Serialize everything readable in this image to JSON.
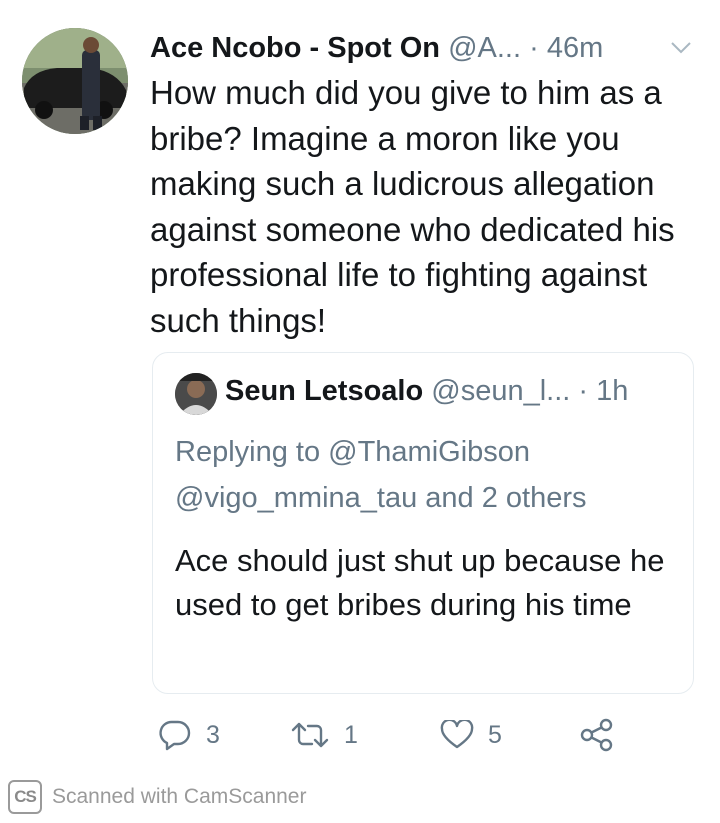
{
  "tweet": {
    "author_name": "Ace Ncobo - Spot On",
    "handle": "@A...",
    "separator": "·",
    "time": "46m",
    "text": "How much did you give to him as a bribe? Imagine a moron like you making such a ludicrous allegation against someone who dedicated his professional life to fighting against such things!",
    "avatar_icon": "profile-photo-man-with-car",
    "menu_icon": "chevron-down-icon"
  },
  "quoted_tweet": {
    "author_name": "Seun Letsoalo",
    "handle": "@seun_l...",
    "separator": "·",
    "time": "1h",
    "replying_line1": "Replying to @ThamiGibson",
    "replying_line2": "@vigo_mmina_tau and 2 others",
    "text": "Ace should just shut up because he used to get bribes during his time",
    "avatar_icon": "profile-photo-small"
  },
  "actions": {
    "reply_count": "3",
    "retweet_count": "1",
    "like_count": "5",
    "reply_icon": "reply-icon",
    "retweet_icon": "retweet-icon",
    "like_icon": "heart-icon",
    "share_icon": "share-icon"
  },
  "watermark": {
    "logo_text": "CS",
    "text": "Scanned with CamScanner"
  },
  "colors": {
    "text_primary": "#14171a",
    "text_secondary": "#657786",
    "border": "#e6ecf0",
    "background": "#ffffff"
  }
}
